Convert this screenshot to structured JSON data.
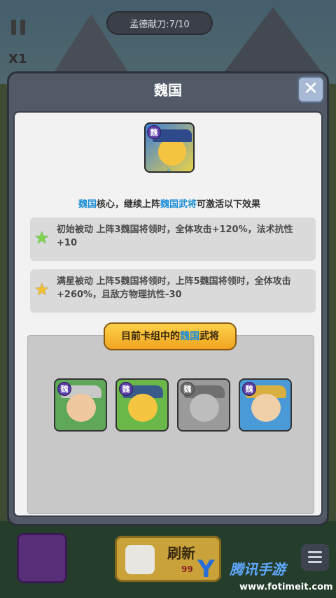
{
  "hud": {
    "top_status": "孟德献刀:7/10",
    "speed": "X1"
  },
  "modal": {
    "title": "魏国",
    "close_label": "✕",
    "hero_badge": "魏",
    "description": {
      "part1": "魏国",
      "part2": "核心，继续上阵",
      "part3": "魏国武将",
      "part4": "可激活以下效果"
    },
    "effects": [
      {
        "star": "green-star",
        "text": "初始被动 上阵3魏国将领时，全体攻击+120%，法术抗性+10"
      },
      {
        "star": "gold-star",
        "text": "满星被动 上阵5魏国将领时，上阵5魏国将领时，全体攻击+260%，且敌方物理抗性-30"
      }
    ],
    "team_title": {
      "prefix": "目前卡组中的",
      "highlight": "魏国",
      "suffix": "武将"
    },
    "cards": [
      {
        "badge": "魏",
        "state": "active",
        "bg": "#5fa85a"
      },
      {
        "badge": "魏",
        "state": "active",
        "bg": "#6ab84a"
      },
      {
        "badge": "魏",
        "state": "inactive",
        "bg": "#9a9a9a"
      },
      {
        "badge": "魏",
        "state": "active",
        "bg": "#4a9ad8"
      }
    ]
  },
  "bottom": {
    "refresh_label": "刷新",
    "refresh_cost": "99"
  },
  "watermark": {
    "logo_text": "Y",
    "site_name": "腾讯手游",
    "url": "www.fotimeit.com"
  },
  "colors": {
    "highlight_blue": "#1e8fd6",
    "modal_frame": "#525a68",
    "title_button": "#f0a420"
  }
}
